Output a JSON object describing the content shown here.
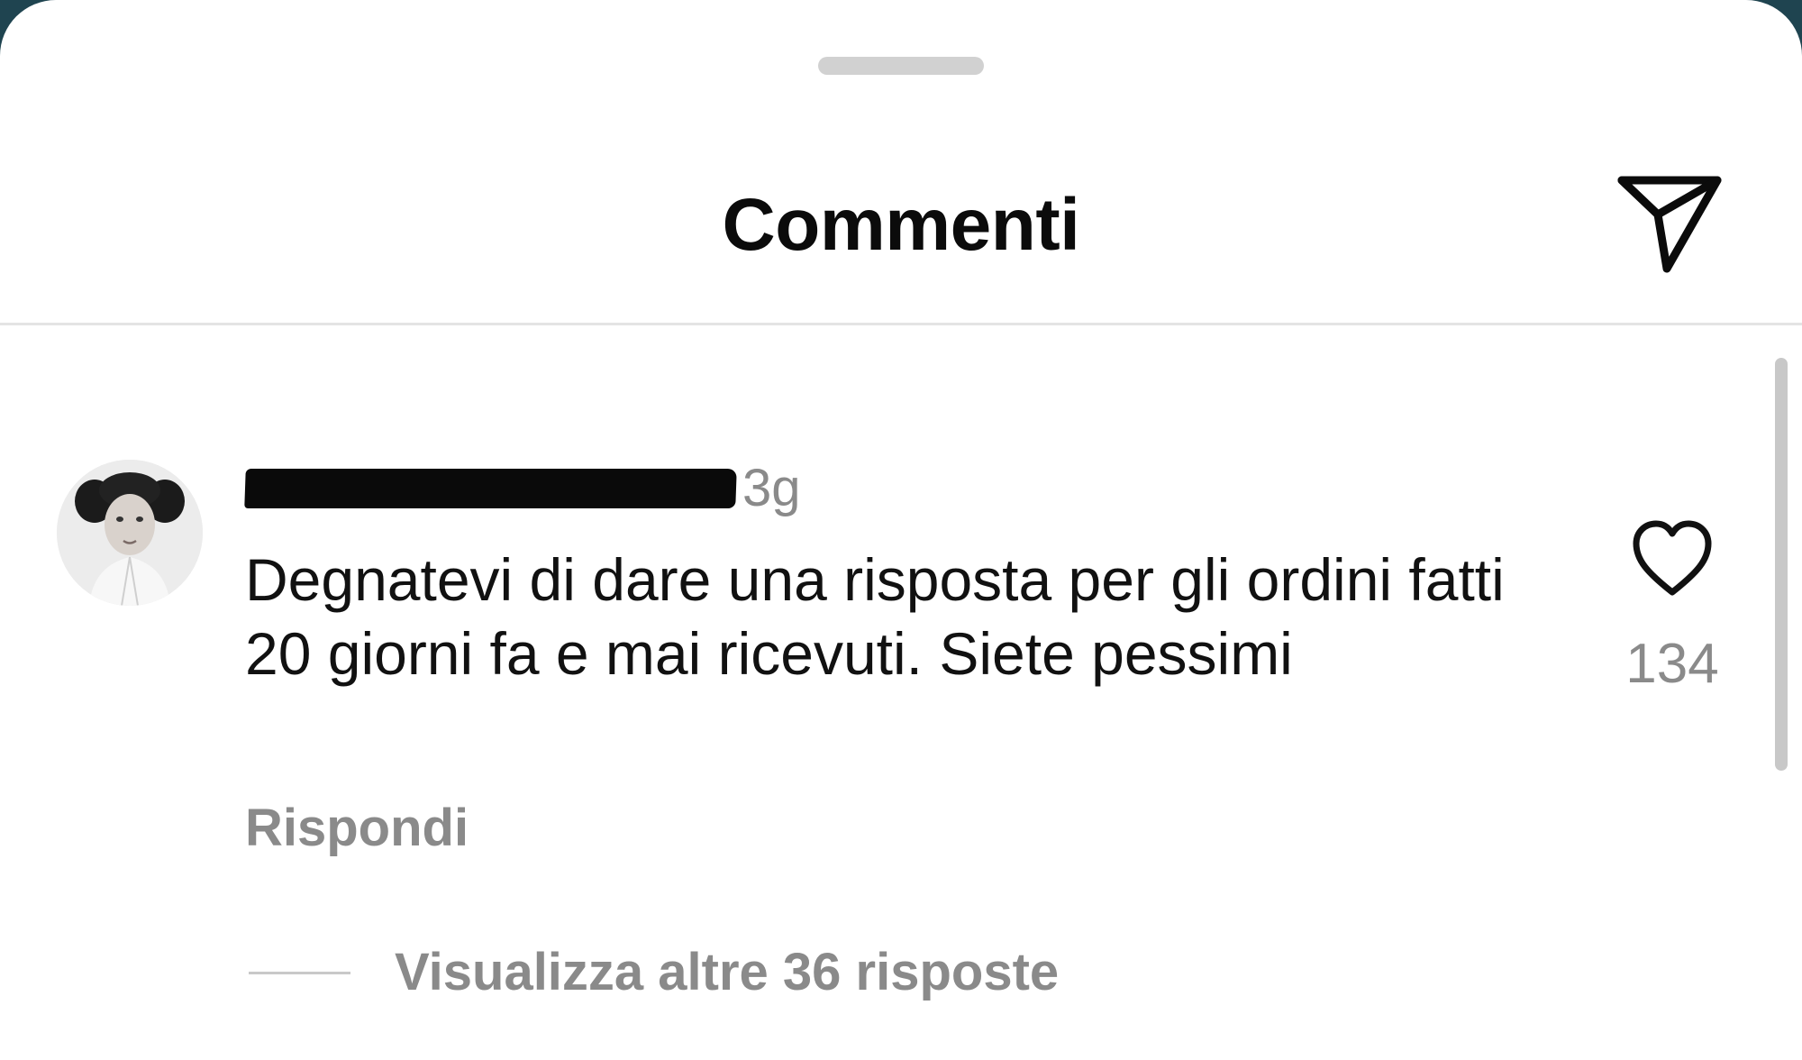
{
  "header": {
    "title": "Commenti",
    "share_icon": "send-icon"
  },
  "comment": {
    "avatar_icon": "avatar-portrait",
    "username": "",
    "username_redacted": true,
    "time": "3g",
    "text": "Degnatevi di dare una risposta per gli ordini fatti 20 giorni fa e mai ricevuti. Siete pessimi",
    "reply_label": "Rispondi",
    "like_icon": "heart-outline-icon",
    "like_count": "134",
    "view_replies_label": "Visualizza altre 36 risposte"
  },
  "colors": {
    "background_behind_sheet": "#1f4450",
    "sheet": "#ffffff",
    "primary_text": "#111111",
    "secondary_text": "#8a8a8a",
    "redaction": "#0a0a0a"
  }
}
